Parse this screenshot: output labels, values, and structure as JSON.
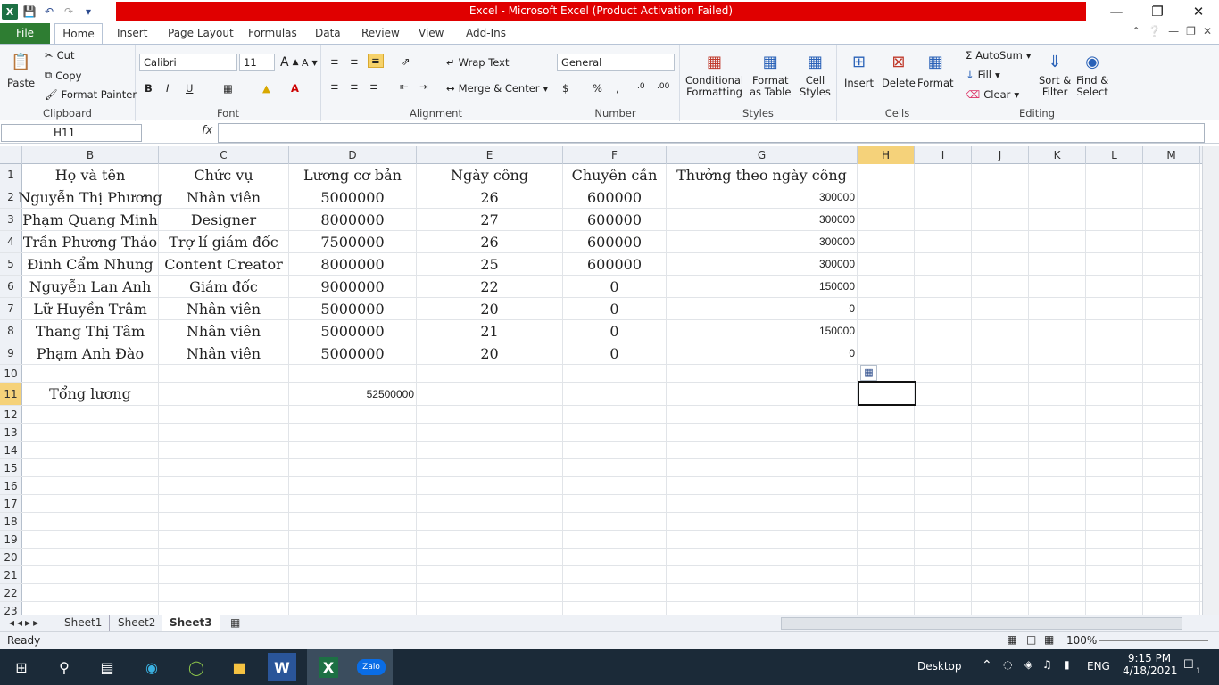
{
  "window": {
    "title": "Excel - Microsoft Excel (Product Activation Failed)"
  },
  "qat": {
    "app_icon": "X",
    "save_icon": "save-icon",
    "undo_icon": "undo-icon",
    "redo_icon": "redo-icon"
  },
  "tabs": [
    "File",
    "Home",
    "Insert",
    "Page Layout",
    "Formulas",
    "Data",
    "Review",
    "View",
    "Add-Ins"
  ],
  "ribbon": {
    "clipboard": {
      "label": "Clipboard",
      "paste": "Paste",
      "cut": "Cut",
      "copy": "Copy",
      "format_painter": "Format Painter"
    },
    "font": {
      "label": "Font",
      "name": "Calibri",
      "size": "11"
    },
    "alignment": {
      "label": "Alignment",
      "wrap": "Wrap Text",
      "merge": "Merge & Center"
    },
    "number": {
      "label": "Number",
      "format": "General"
    },
    "styles": {
      "label": "Styles",
      "conditional": "Conditional",
      "conditional2": "Formatting",
      "format_table": "Format",
      "format_table2": "as Table",
      "cell_styles": "Cell",
      "cell_styles2": "Styles"
    },
    "cells": {
      "label": "Cells",
      "insert": "Insert",
      "delete": "Delete",
      "format": "Format"
    },
    "editing": {
      "label": "Editing",
      "autosum": "AutoSum",
      "fill": "Fill",
      "clear": "Clear",
      "sort": "Sort &",
      "sort2": "Filter",
      "find": "Find &",
      "find2": "Select"
    }
  },
  "formula_bar": {
    "name_box": "H11",
    "fx": "fx",
    "content": ""
  },
  "columns": [
    "B",
    "C",
    "D",
    "E",
    "F",
    "G",
    "H",
    "I",
    "J",
    "K",
    "L",
    "M"
  ],
  "rows": [
    {
      "n": "1",
      "cells": [
        "Họ và tên",
        "Chức vụ",
        "Lương cơ bản",
        "Ngày công",
        "Chuyên cần",
        "Thưởng theo ngày công"
      ]
    },
    {
      "n": "2",
      "cells": [
        "Nguyễn Thị Phương",
        "Nhân viên",
        "5000000",
        "26",
        "600000",
        "300000"
      ]
    },
    {
      "n": "3",
      "cells": [
        "Phạm Quang Minh",
        "Designer",
        "8000000",
        "27",
        "600000",
        "300000"
      ]
    },
    {
      "n": "4",
      "cells": [
        "Trần Phương Thảo",
        "Trợ lí giám đốc",
        "7500000",
        "26",
        "600000",
        "300000"
      ]
    },
    {
      "n": "5",
      "cells": [
        "Đinh Cẩm Nhung",
        "Content Creator",
        "8000000",
        "25",
        "600000",
        "300000"
      ]
    },
    {
      "n": "6",
      "cells": [
        "Nguyễn Lan Anh",
        "Giám đốc",
        "9000000",
        "22",
        "0",
        "150000"
      ]
    },
    {
      "n": "7",
      "cells": [
        "Lữ Huyền Trâm",
        "Nhân viên",
        "5000000",
        "20",
        "0",
        "0"
      ]
    },
    {
      "n": "8",
      "cells": [
        "Thang Thị Tâm",
        "Nhân viên",
        "5000000",
        "21",
        "0",
        "150000"
      ]
    },
    {
      "n": "9",
      "cells": [
        "Phạm Anh Đào",
        "Nhân viên",
        "5000000",
        "20",
        "0",
        "0"
      ]
    },
    {
      "n": "10",
      "cells": [
        "",
        "",
        "",
        "",
        "",
        ""
      ]
    },
    {
      "n": "11",
      "cells": [
        "Tổng lương",
        "",
        "52500000",
        "",
        "",
        ""
      ]
    },
    {
      "n": "12",
      "cells": []
    },
    {
      "n": "13",
      "cells": []
    },
    {
      "n": "14",
      "cells": []
    },
    {
      "n": "15",
      "cells": []
    },
    {
      "n": "16",
      "cells": []
    },
    {
      "n": "17",
      "cells": []
    },
    {
      "n": "18",
      "cells": []
    },
    {
      "n": "19",
      "cells": []
    },
    {
      "n": "20",
      "cells": []
    },
    {
      "n": "21",
      "cells": []
    },
    {
      "n": "22",
      "cells": []
    },
    {
      "n": "23",
      "cells": []
    }
  ],
  "sheets": [
    "Sheet1",
    "Sheet2",
    "Sheet3"
  ],
  "active_sheet": "Sheet3",
  "status": {
    "ready": "Ready",
    "zoom": "100%"
  },
  "taskbar": {
    "desktop": "Desktop",
    "lang": "ENG",
    "time": "9:15 PM",
    "date": "4/18/2021",
    "notif_count": "1",
    "zalo": "Zalo"
  }
}
